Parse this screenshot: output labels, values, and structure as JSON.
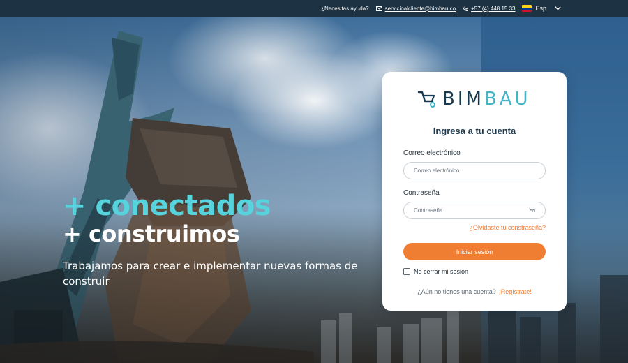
{
  "topbar": {
    "help": "¿Necesitas ayuda?",
    "email": "servicioalcliente@bimbau.co",
    "phone": "+57 (4) 448 15 33",
    "language": "Esp"
  },
  "hero": {
    "headline_1": "+ conectados",
    "headline_2": "+ construimos",
    "tagline": "Trabajamos para crear e implementar nuevas formas de construir"
  },
  "login": {
    "brand_part1": "BIM",
    "brand_part2": "BAU",
    "title": "Ingresa a tu cuenta",
    "email_label": "Correo electrónico",
    "email_placeholder": "Correo electrónico",
    "password_label": "Contraseña",
    "password_placeholder": "Contraseña",
    "forgot": "¿Olvidaste tu constraseña?",
    "submit": "Iniciar sesión",
    "remember": "No cerrar mi sesión",
    "no_account": "¿Aún no tienes una cuenta?",
    "register": "¡Regístrate!"
  },
  "colors": {
    "topbar_bg": "#1d3343",
    "accent_orange": "#f07e32",
    "headline_cyan": "#56d3dc",
    "brand_dark": "#173a50",
    "brand_light": "#41b5c9"
  },
  "icons": [
    "mail-icon",
    "phone-icon",
    "colombia-flag-icon",
    "chevron-down-icon",
    "wheelbarrow-logo-icon",
    "eye-closed-icon"
  ]
}
